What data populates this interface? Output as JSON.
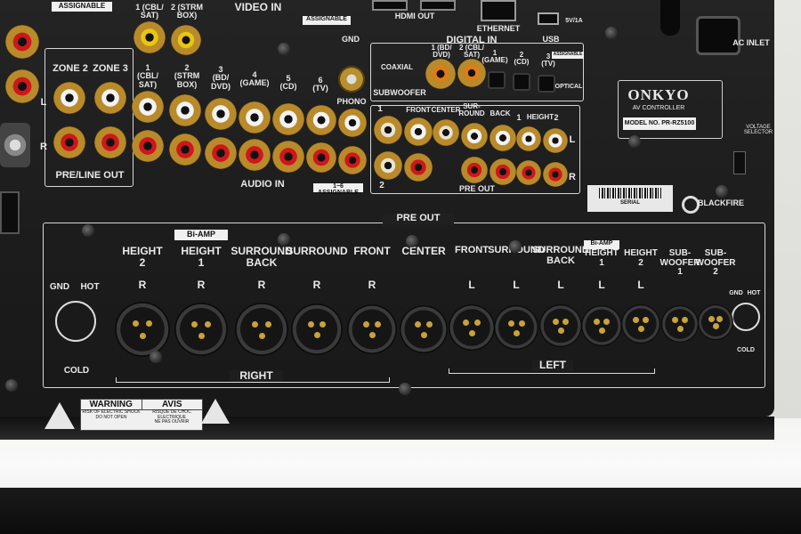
{
  "labels": {
    "assignable_tl": "ASSIGNABLE",
    "video_in": "VIDEO IN",
    "video_in_1": "1 (CBL/\nSAT)",
    "video_in_2": "2 (STRM\nBOX)",
    "assignable_video": "ASSIGNABLE",
    "gnd": "GND",
    "hdmi_out": "HDMI OUT",
    "ethernet": "ETHERNET",
    "usb": "USB",
    "usb_rating": "5V/1A",
    "digital_in": "DIGITAL IN",
    "coaxial": "COAXIAL",
    "coax_1": "1 (BD/\nDVD)",
    "coax_2": "2 (CBL/\nSAT)",
    "optical": "OPTICAL",
    "opt_1": "1\n(GAME)",
    "opt_2": "2\n(CD)",
    "opt_3": "3\n(TV)",
    "assignable_digital": "ASSIGNABLE",
    "zone2": "ZONE 2",
    "zone3": "ZONE 3",
    "l": "L",
    "r": "R",
    "pre_line_out": "PRE/LINE OUT",
    "audio_in_1": "1\n(CBL/\nSAT)",
    "audio_in_2": "2\n(STRM\nBOX)",
    "audio_in_3": "3\n(BD/\nDVD)",
    "audio_in_4": "4\n(GAME)",
    "audio_in_5": "5\n(CD)",
    "audio_in_6": "6\n(TV)",
    "phono": "PHONO",
    "audio_in": "AUDIO IN",
    "assignable_audio": "1~6 ASSIGNABLE",
    "subwoofer": "SUBWOOFER",
    "sw1": "1",
    "sw2": "2",
    "front": "FRONT",
    "center": "CENTER",
    "surround": "SUR-\nROUND",
    "back": "BACK",
    "height": "HEIGHT",
    "h1": "1",
    "h2": "2",
    "pre_out_top": "PRE OUT",
    "onkyo": "ONKYO",
    "av_controller": "AV CONTROLLER",
    "model": "MODEL NO. PR-RZ5100",
    "ac_inlet": "AC INLET",
    "voltage": "VOLTAGE\nSELECTOR",
    "blackfire": "BLACKFIRE",
    "serial": "SERIAL",
    "pre_out": "PRE OUT",
    "xlr_gnd": "GND",
    "xlr_hot": "HOT",
    "xlr_cold": "COLD",
    "right": "RIGHT",
    "left": "LEFT",
    "bi_amp": "Bi-AMP",
    "warning": "WARNING",
    "avis": "AVIS",
    "warn_text": "RISK OF ELECTRIC SHOCK\nDO NOT OPEN",
    "avis_text": "RISQUE DE CHOC ELECTRIQUE\nNE PAS OUVRIR"
  },
  "xlr_channels": [
    {
      "name": "HEIGHT\n2",
      "side": "R",
      "biamp": false
    },
    {
      "name": "HEIGHT\n1",
      "side": "R",
      "biamp": true
    },
    {
      "name": "SURROUND\nBACK",
      "side": "R",
      "biamp": false
    },
    {
      "name": "SURROUND",
      "side": "R",
      "biamp": false
    },
    {
      "name": "FRONT",
      "side": "R",
      "biamp": false
    },
    {
      "name": "CENTER",
      "side": "",
      "biamp": false
    },
    {
      "name": "FRONT",
      "side": "L",
      "biamp": false
    },
    {
      "name": "SURROUND",
      "side": "L",
      "biamp": false
    },
    {
      "name": "SURROUND\nBACK",
      "side": "L",
      "biamp": false
    },
    {
      "name": "HEIGHT\n1",
      "side": "L",
      "biamp": true
    },
    {
      "name": "HEIGHT\n2",
      "side": "L",
      "biamp": false
    },
    {
      "name": "SUB-\nWOOFER\n1",
      "side": "",
      "biamp": false
    },
    {
      "name": "SUB-\nWOOFER\n2",
      "side": "",
      "biamp": false
    }
  ]
}
